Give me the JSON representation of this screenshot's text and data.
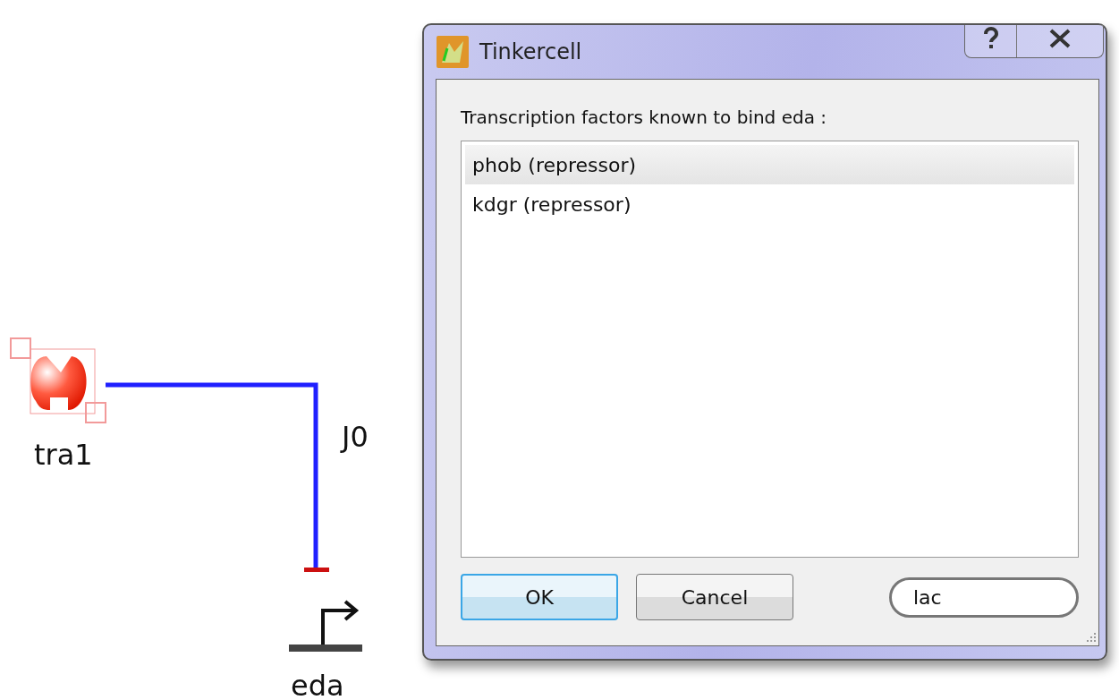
{
  "diagram": {
    "nodes": [
      {
        "kind": "protein",
        "label": "tra1",
        "selected": true
      },
      {
        "kind": "promoter",
        "label": "eda",
        "selected": false
      }
    ],
    "edges": [
      {
        "kind": "repression",
        "label": "J0"
      }
    ]
  },
  "dialog": {
    "title": "Tinkercell",
    "prompt": "Transcription factors known to bind eda :",
    "items": [
      {
        "label": "phob (repressor)",
        "selected": true
      },
      {
        "label": "kdgr (repressor)",
        "selected": false
      }
    ],
    "buttons": [
      {
        "label": "OK",
        "default": true
      },
      {
        "label": "Cancel",
        "default": false
      }
    ],
    "field": {
      "value": "lac"
    }
  }
}
